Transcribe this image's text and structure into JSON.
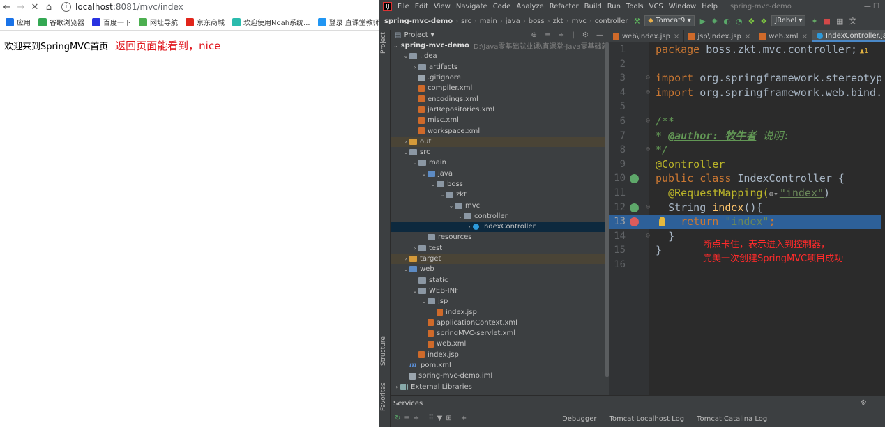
{
  "browser": {
    "url_host": "localhost",
    "url_path": ":8081/mvc/index",
    "bookmarks": [
      {
        "label": "应用",
        "color": "#1a73e8"
      },
      {
        "label": "谷歌浏览器",
        "color": "#34a853"
      },
      {
        "label": "百度一下",
        "color": "#2932e1"
      },
      {
        "label": "网址导航",
        "color": "#4caf50"
      },
      {
        "label": "京东商城",
        "color": "#e1251b"
      },
      {
        "label": "欢迎使用Noah系统...",
        "color": "#2bbbad"
      },
      {
        "label": "登录 直课堂教师",
        "color": "#2196f3"
      }
    ],
    "page_text": "欢迎来到SpringMVC首页",
    "annotation": "返回页面能看到，nice"
  },
  "ide": {
    "menu": [
      "File",
      "Edit",
      "View",
      "Navigate",
      "Code",
      "Analyze",
      "Refactor",
      "Build",
      "Run",
      "Tools",
      "VCS",
      "Window",
      "Help"
    ],
    "project_title": "spring-mvc-demo",
    "breadcrumbs": [
      "spring-mvc-demo",
      "src",
      "main",
      "java",
      "boss",
      "zkt",
      "mvc",
      "controller"
    ],
    "run_config": "Tomcat9",
    "jrebel": "JRebel",
    "project_panel_title": "Project",
    "strip_project": "Project",
    "strip_structure": "Structure",
    "strip_favorites": "Favorites",
    "tree": [
      {
        "label": "spring-mvc-demo",
        "path": "D:\\Java零基础就业课\\直课堂-Java零基础就业课",
        "depth": 0,
        "arrow": "v",
        "icon": "folder",
        "bold": true
      },
      {
        "label": ".idea",
        "depth": 1,
        "arrow": "v",
        "icon": "folder"
      },
      {
        "label": "artifacts",
        "depth": 2,
        "arrow": ">",
        "icon": "folder"
      },
      {
        "label": ".gitignore",
        "depth": 2,
        "arrow": "",
        "icon": "file"
      },
      {
        "label": "compiler.xml",
        "depth": 2,
        "arrow": "",
        "icon": "xml"
      },
      {
        "label": "encodings.xml",
        "depth": 2,
        "arrow": "",
        "icon": "xml"
      },
      {
        "label": "jarRepositories.xml",
        "depth": 2,
        "arrow": "",
        "icon": "xml"
      },
      {
        "label": "misc.xml",
        "depth": 2,
        "arrow": "",
        "icon": "xml"
      },
      {
        "label": "workspace.xml",
        "depth": 2,
        "arrow": "",
        "icon": "xml"
      },
      {
        "label": "out",
        "depth": 1,
        "arrow": ">",
        "icon": "folder-orange",
        "excluded": true
      },
      {
        "label": "src",
        "depth": 1,
        "arrow": "v",
        "icon": "folder"
      },
      {
        "label": "main",
        "depth": 2,
        "arrow": "v",
        "icon": "folder"
      },
      {
        "label": "java",
        "depth": 3,
        "arrow": "v",
        "icon": "folder-blue"
      },
      {
        "label": "boss",
        "depth": 4,
        "arrow": "v",
        "icon": "folder"
      },
      {
        "label": "zkt",
        "depth": 5,
        "arrow": "v",
        "icon": "folder"
      },
      {
        "label": "mvc",
        "depth": 6,
        "arrow": "v",
        "icon": "folder"
      },
      {
        "label": "controller",
        "depth": 7,
        "arrow": "v",
        "icon": "folder"
      },
      {
        "label": "IndexController",
        "depth": 8,
        "arrow": ">",
        "icon": "class",
        "selected": true
      },
      {
        "label": "resources",
        "depth": 3,
        "arrow": "",
        "icon": "folder"
      },
      {
        "label": "test",
        "depth": 2,
        "arrow": ">",
        "icon": "folder"
      },
      {
        "label": "target",
        "depth": 1,
        "arrow": ">",
        "icon": "folder-orange",
        "excluded": true
      },
      {
        "label": "web",
        "depth": 1,
        "arrow": "v",
        "icon": "folder-blue"
      },
      {
        "label": "static",
        "depth": 2,
        "arrow": "",
        "icon": "folder"
      },
      {
        "label": "WEB-INF",
        "depth": 2,
        "arrow": "v",
        "icon": "folder"
      },
      {
        "label": "jsp",
        "depth": 3,
        "arrow": "v",
        "icon": "folder"
      },
      {
        "label": "index.jsp",
        "depth": 4,
        "arrow": "",
        "icon": "xml"
      },
      {
        "label": "applicationContext.xml",
        "depth": 3,
        "arrow": "",
        "icon": "xml"
      },
      {
        "label": "springMVC-servlet.xml",
        "depth": 3,
        "arrow": "",
        "icon": "xml"
      },
      {
        "label": "web.xml",
        "depth": 3,
        "arrow": "",
        "icon": "xml"
      },
      {
        "label": "index.jsp",
        "depth": 2,
        "arrow": "",
        "icon": "xml"
      },
      {
        "label": "pom.xml",
        "depth": 1,
        "arrow": "",
        "icon": "maven"
      },
      {
        "label": "spring-mvc-demo.iml",
        "depth": 1,
        "arrow": "",
        "icon": "file"
      },
      {
        "label": "External Libraries",
        "depth": 0,
        "arrow": ">",
        "icon": "lib"
      }
    ],
    "tabs": [
      {
        "label": "web\\index.jsp",
        "active": false
      },
      {
        "label": "jsp\\index.jsp",
        "active": false
      },
      {
        "label": "web.xml",
        "active": false
      },
      {
        "label": "IndexController.java",
        "active": true
      }
    ],
    "code": {
      "l1": "boss.zkt.mvc.controller;",
      "l1_warn": "▲1",
      "l3": "org.springframework.stereotyp",
      "l4": "org.springframework.web.bind.",
      "l6": "/**",
      "l7_tag": "@author: 牧牛者",
      "l7_rest": " 说明:",
      "l8": " */",
      "l9": "@Controller",
      "l10_name": "IndexController {",
      "l11_ann": "@RequestMapping(",
      "l11_str": "\"index\"",
      "l11_end": ")",
      "l12_type": "String ",
      "l12_fn": "index",
      "l12_end": "(){",
      "l13_str": "\"index\"",
      "l13_end": ";",
      "l14": "}",
      "l15": "}",
      "kw_package": "package",
      "kw_import": "import",
      "kw_public": "public",
      "kw_class": "class",
      "kw_return": "return",
      "line_numbers": [
        "1",
        "2",
        "3",
        "4",
        "5",
        "6",
        "7",
        "8",
        "9",
        "10",
        "11",
        "12",
        "13",
        "14",
        "15",
        "16"
      ]
    },
    "note_line1": "断点卡住，表示进入到控制器，",
    "note_line2": "完美一次创建SpringMVC项目成功",
    "services_title": "Services",
    "services_tabs": [
      "Debugger",
      "Tomcat Localhost Log",
      "Tomcat Catalina Log"
    ]
  }
}
